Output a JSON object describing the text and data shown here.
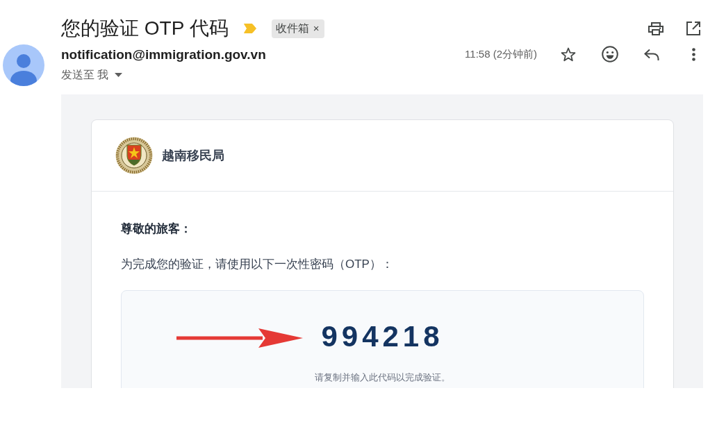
{
  "subject": {
    "title": "您的验证 OTP 代码",
    "important": true,
    "labels": [
      {
        "text": "收件箱",
        "remove": "×"
      }
    ]
  },
  "message": {
    "sender": "notification@immigration.gov.vn",
    "recipient": "发送至 我",
    "time": "11:58 (2分钟前)",
    "starred": false
  },
  "email": {
    "organization": "越南移民局",
    "greeting": "尊敬的旅客：",
    "intro": "为完成您的验证，请使用以下一次性密码（OTP）：",
    "otp_code": "994218",
    "hint": "请复制并输入此代码以完成验证。"
  }
}
